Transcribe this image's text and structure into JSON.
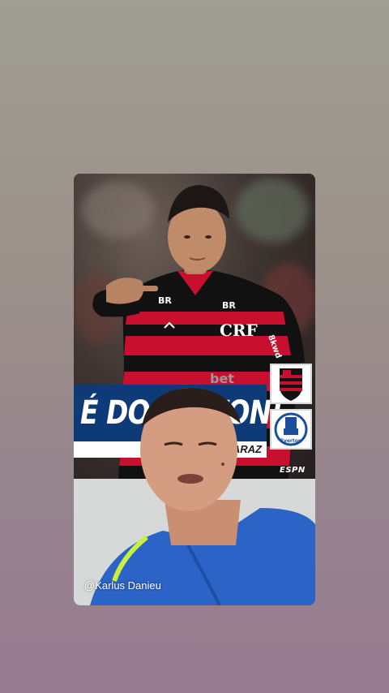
{
  "post": {
    "headline": "É DO EVERTON!",
    "headline_visible": "É DO EV",
    "headline_visible_end": "TON!",
    "subtitle": "GARAZ",
    "broadcaster": "ESPN",
    "creator_handle": "@Karlus Danieu"
  },
  "jersey": {
    "sponsor_left": "BR",
    "sponsor_right": "BR",
    "sleeve": "8kwd",
    "chest": "CRF",
    "belly": "bet"
  },
  "crests": {
    "top": "Flamengo",
    "bottom_label": "Everton"
  },
  "colors": {
    "banner_blue": "#0f3a78",
    "flamengo_red": "#c8102e",
    "flamengo_black": "#111111",
    "everton_blue": "#1b4f9c",
    "creator_shirt": "#2b63c6"
  }
}
